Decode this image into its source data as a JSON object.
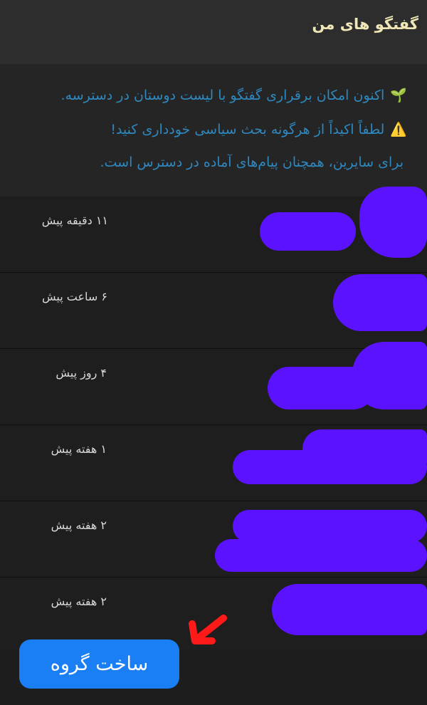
{
  "header": {
    "title": "گفتگو های من"
  },
  "notice": {
    "line1": {
      "icon": "🌱",
      "text": "اکنون امکان برقراری گفتگو با لیست دوستان در دسترسه."
    },
    "line2": {
      "icon": "⚠️",
      "text": "لطفاً اکیداً از هرگونه بحث سیاسی خودداری کنید!"
    },
    "line3": {
      "text": "برای سایرین، همچنان پیام‌های آماده در دسترس است."
    }
  },
  "conversations": [
    {
      "time": "۱۱ دقیقه پیش"
    },
    {
      "time": "۶ ساعت پیش"
    },
    {
      "time": "۴ روز پیش"
    },
    {
      "time": "۱ هفته پیش"
    },
    {
      "time": "۲ هفته پیش"
    },
    {
      "time": "۲ هفته پیش"
    }
  ],
  "create_group_button": {
    "label": "ساخت  گروه"
  },
  "colors": {
    "accent": "#1a7ff4",
    "notice_text": "#2f88bf",
    "header_title": "#efe7b6",
    "redaction": "#5b13ff",
    "arrow": "#ff1a1a"
  }
}
